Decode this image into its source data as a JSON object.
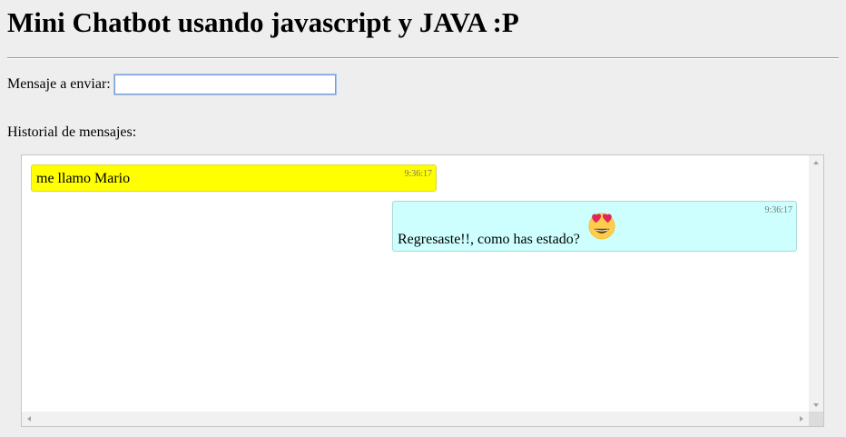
{
  "header": {
    "title": "Mini Chatbot usando javascript y JAVA :P"
  },
  "compose": {
    "label": "Mensaje a enviar:",
    "value": "",
    "placeholder": ""
  },
  "history": {
    "label": "Historial de mensajes:",
    "messages": [
      {
        "sender": "user",
        "text": "me llamo Mario",
        "time": "9:36:17"
      },
      {
        "sender": "bot",
        "text": "Regresaste!!, como has estado?",
        "time": "9:36:17",
        "icon": "heart-eyes-emoji-icon"
      }
    ]
  },
  "colors": {
    "user_bubble": "#ffff00",
    "bot_bubble": "#ccfffe",
    "background": "#eeeeee"
  }
}
